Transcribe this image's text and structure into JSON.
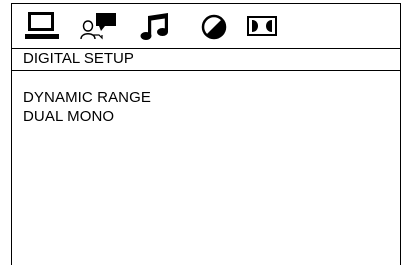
{
  "tabs": [
    {
      "icon": "monitor-icon"
    },
    {
      "icon": "speaker-chat-icon"
    },
    {
      "icon": "music-note-icon"
    },
    {
      "icon": "contrast-icon"
    },
    {
      "icon": "dolby-digital-icon"
    }
  ],
  "section": {
    "title": "DIGITAL SETUP"
  },
  "menu": {
    "items": [
      {
        "label": "DYNAMIC RANGE"
      },
      {
        "label": "DUAL MONO"
      }
    ]
  },
  "colors": {
    "foreground": "#000000",
    "background": "#ffffff"
  }
}
